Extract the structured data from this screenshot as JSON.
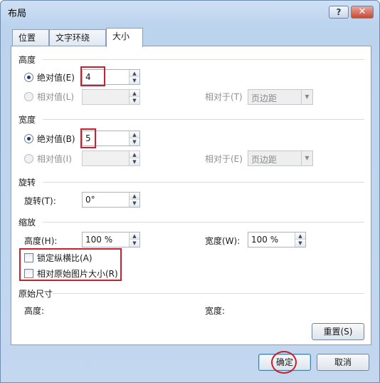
{
  "window": {
    "title": "布局",
    "help_label": "?",
    "close_label": "✕"
  },
  "tabs": [
    {
      "label": "位置"
    },
    {
      "label": "文字环绕"
    },
    {
      "label": "大小"
    }
  ],
  "height_section": {
    "title": "高度",
    "absolute_label": "绝对值(E)",
    "absolute_value": "4",
    "relative_label": "相对值(L)",
    "relative_to_label": "相对于(T)",
    "relative_to_value": "页边距"
  },
  "width_section": {
    "title": "宽度",
    "absolute_label": "绝对值(B)",
    "absolute_value": "5",
    "relative_label": "相对值(I)",
    "relative_to_label": "相对于(E)",
    "relative_to_value": "页边距"
  },
  "rotate_section": {
    "title": "旋转",
    "rotate_label": "旋转(T):",
    "rotate_value": "0°"
  },
  "scale_section": {
    "title": "缩放",
    "height_label": "高度(H):",
    "height_value": "100 %",
    "width_label": "宽度(W):",
    "width_value": "100 %",
    "lock_aspect_label": "锁定纵横比(A)",
    "relative_original_label": "相对原始图片大小(R)"
  },
  "original_section": {
    "title": "原始尺寸",
    "height_label": "高度:",
    "width_label": "宽度:"
  },
  "buttons": {
    "reset_label": "重置(S)",
    "ok_label": "确定",
    "cancel_label": "取消"
  },
  "colors": {
    "annotation_red": "#c8202d",
    "title_bar": "#bcd3ee"
  }
}
